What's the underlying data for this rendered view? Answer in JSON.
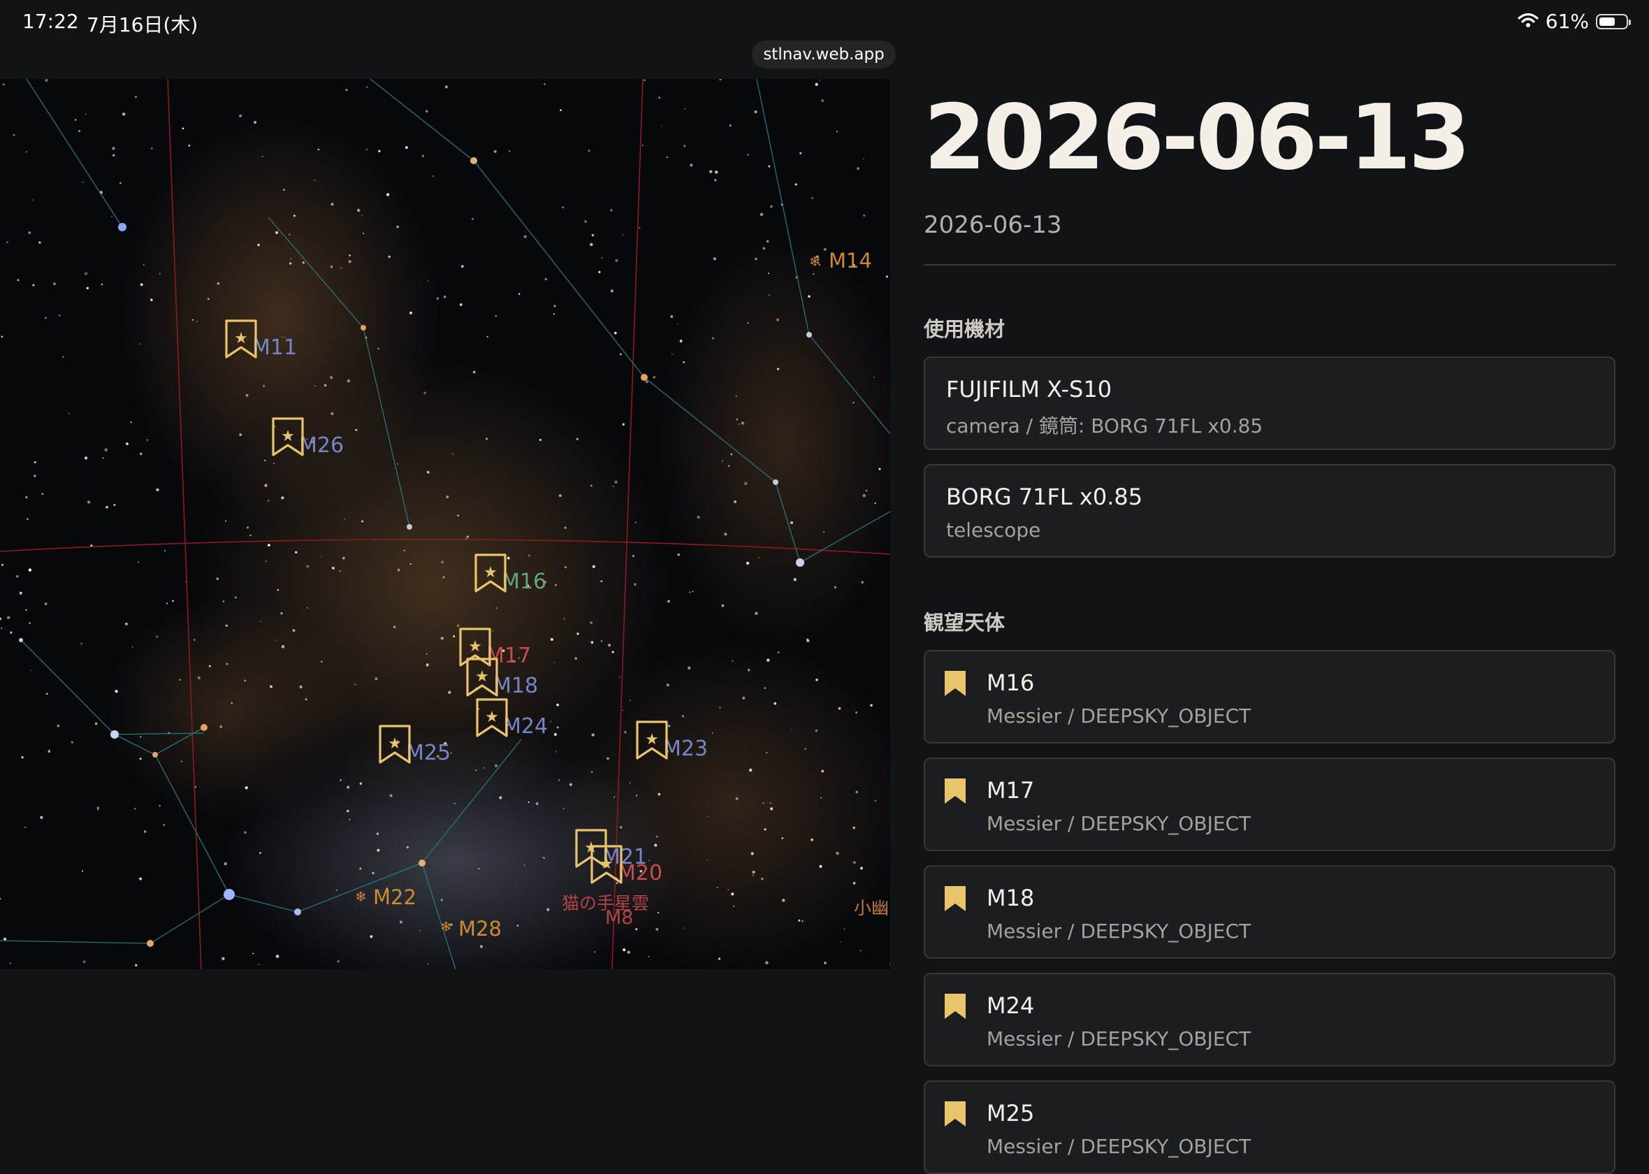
{
  "status_bar": {
    "time": "17:22",
    "date": "7月16日(木)",
    "battery_percent": "61%",
    "battery_level": 0.61
  },
  "browser": {
    "url": "stlnav.web.app"
  },
  "colors": {
    "background": "#121316",
    "accent_gold": "#e9c46a",
    "label_blue": "#7486c9",
    "label_red": "#c94b4b",
    "label_green": "#5fa877",
    "label_orange": "#d08a2e",
    "grid_red": "#8e1b1b",
    "constellation_line": "#2a7f86"
  },
  "sky_map": {
    "markers": [
      {
        "label": "M11",
        "kind": "bookmark",
        "color": "blue"
      },
      {
        "label": "M26",
        "kind": "bookmark",
        "color": "blue"
      },
      {
        "label": "M16",
        "kind": "bookmark",
        "color": "green"
      },
      {
        "label": "M17",
        "kind": "bookmark",
        "color": "red"
      },
      {
        "label": "M18",
        "kind": "bookmark",
        "color": "blue"
      },
      {
        "label": "M24",
        "kind": "bookmark",
        "color": "blue"
      },
      {
        "label": "M25",
        "kind": "bookmark",
        "color": "blue"
      },
      {
        "label": "M23",
        "kind": "bookmark",
        "color": "blue"
      },
      {
        "label": "M21",
        "kind": "bookmark",
        "color": "blue"
      },
      {
        "label": "M20",
        "kind": "bookmark",
        "color": "red"
      }
    ],
    "clusters": [
      {
        "label": "M14",
        "icon": "cluster-icon"
      },
      {
        "label": "M22",
        "icon": "cluster-icon"
      },
      {
        "label": "M28",
        "icon": "cluster-icon"
      }
    ],
    "nebula_labels": [
      {
        "label": "猫の手星雲"
      },
      {
        "label": "M8"
      },
      {
        "label": "小幽"
      }
    ]
  },
  "log": {
    "title": "2026-06-13",
    "date": "2026-06-13",
    "equipment_heading": "使用機材",
    "equipment": [
      {
        "name": "FUJIFILM X-S10",
        "detail": "camera / 鏡筒: BORG 71FL x0.85"
      },
      {
        "name": "BORG 71FL x0.85",
        "detail": "telescope"
      }
    ],
    "objects_heading": "観望天体",
    "objects": [
      {
        "name": "M16",
        "detail": "Messier / DEEPSKY_OBJECT",
        "icon": "bookmark-icon"
      },
      {
        "name": "M17",
        "detail": "Messier / DEEPSKY_OBJECT",
        "icon": "bookmark-icon"
      },
      {
        "name": "M18",
        "detail": "Messier / DEEPSKY_OBJECT",
        "icon": "bookmark-icon"
      },
      {
        "name": "M24",
        "detail": "Messier / DEEPSKY_OBJECT",
        "icon": "bookmark-icon"
      },
      {
        "name": "M25",
        "detail": "Messier / DEEPSKY_OBJECT",
        "icon": "bookmark-icon"
      }
    ]
  }
}
